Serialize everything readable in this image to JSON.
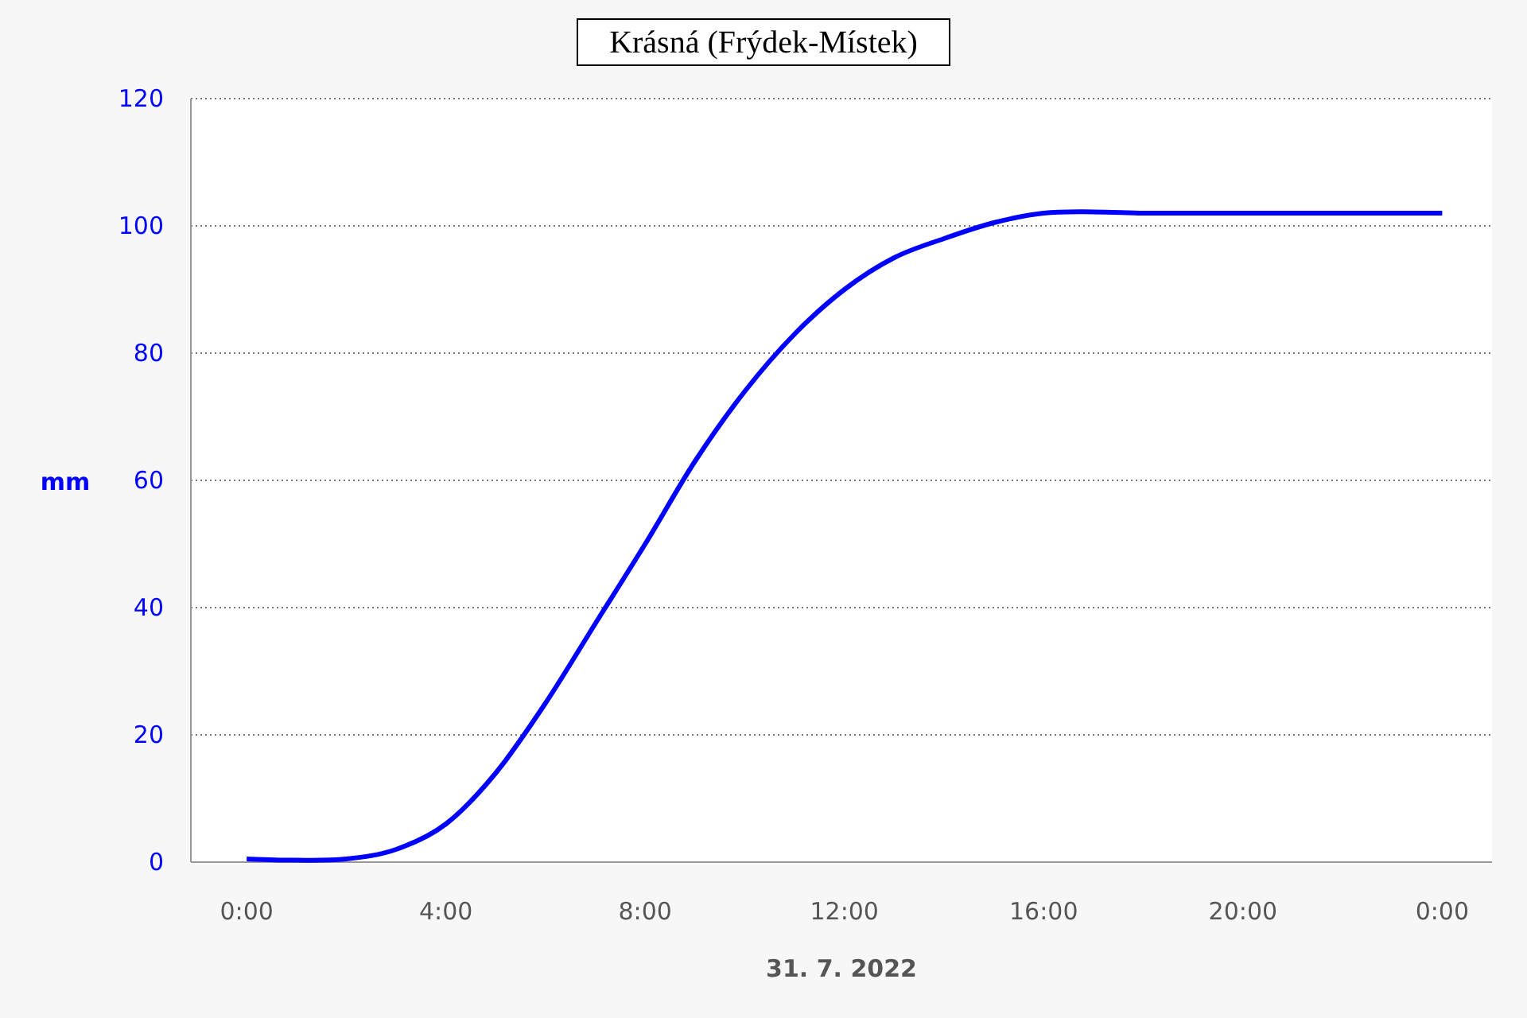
{
  "chart_data": {
    "type": "line",
    "title": "Krásná (Frýdek-Místek)",
    "xlabel": "31. 7. 2022",
    "ylabel": "mm",
    "x": [
      0,
      1,
      2,
      3,
      4,
      5,
      6,
      7,
      8,
      9,
      10,
      11,
      12,
      13,
      14,
      15,
      16,
      17,
      18,
      19,
      20,
      21,
      22,
      23,
      24
    ],
    "series": [
      {
        "color": "#0000ff",
        "values": [
          0.5,
          0.3,
          0.5,
          2,
          6,
          14,
          25,
          37.5,
          50,
          63,
          74,
          83,
          90,
          95,
          98,
          100.5,
          102,
          102.2,
          102,
          102,
          102,
          102,
          102,
          102,
          102
        ]
      }
    ],
    "xlim": [
      -1.12,
      25
    ],
    "ylim": [
      0,
      120
    ],
    "grid": true,
    "xticks": [
      {
        "value": 0,
        "label": "0:00"
      },
      {
        "value": 4,
        "label": "4:00"
      },
      {
        "value": 8,
        "label": "8:00"
      },
      {
        "value": 12,
        "label": "12:00"
      },
      {
        "value": 16,
        "label": "16:00"
      },
      {
        "value": 20,
        "label": "20:00"
      },
      {
        "value": 24,
        "label": "0:00"
      }
    ],
    "yticks": [
      0,
      20,
      40,
      60,
      80,
      100,
      120
    ]
  }
}
